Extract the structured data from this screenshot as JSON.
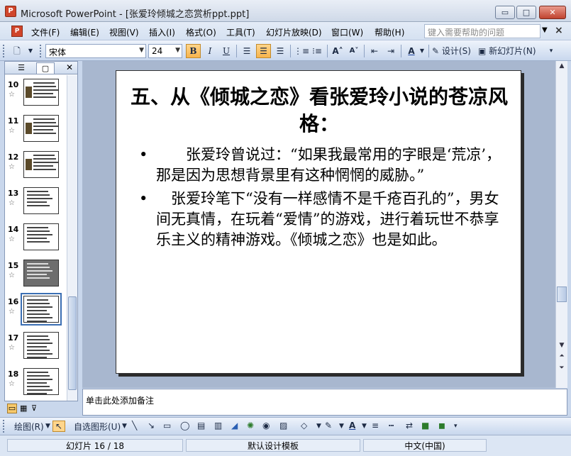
{
  "window": {
    "app_icon_letter": "P",
    "title": "Microsoft PowerPoint - [张爱玲倾城之恋赏析ppt.ppt]",
    "btn_min": "▭",
    "btn_max": "□",
    "btn_close": "✕"
  },
  "menu": {
    "items": [
      "文件(F)",
      "编辑(E)",
      "视图(V)",
      "插入(I)",
      "格式(O)",
      "工具(T)",
      "幻灯片放映(D)",
      "窗口(W)",
      "帮助(H)"
    ],
    "help_placeholder": "键入需要帮助的问题",
    "close": "×"
  },
  "toolbar": {
    "font_name": "宋体",
    "font_size": "24",
    "bold": "B",
    "italic": "I",
    "underline": "U",
    "design_label": "设计(S)",
    "new_slide_label": "新幻灯片(N)"
  },
  "outline_panel": {
    "slides": [
      {
        "num": "10",
        "style": "pic"
      },
      {
        "num": "11",
        "style": "pic"
      },
      {
        "num": "12",
        "style": "pic"
      },
      {
        "num": "13",
        "style": "plain"
      },
      {
        "num": "14",
        "style": "plain"
      },
      {
        "num": "15",
        "style": "dark"
      },
      {
        "num": "16",
        "style": "text",
        "selected": true
      },
      {
        "num": "17",
        "style": "text"
      },
      {
        "num": "18",
        "style": "text"
      }
    ]
  },
  "slide": {
    "title": "五、从《倾城之恋》看张爱玲小说的苍凉风格：",
    "bullets": [
      "　　张爱玲曾说过：“如果我最常用的字眼是‘荒凉’，那是因为思想背景里有这种惘惘的威胁。”",
      "　张爱玲笔下“没有一样感情不是千疮百孔的”，男女间无真情，在玩着“爱情”的游戏，进行着玩世不恭享乐主义的精神游戏。《倾城之恋》也是如此。"
    ]
  },
  "notes": {
    "placeholder": "单击此处添加备注"
  },
  "drawing_toolbar": {
    "draw_label": "绘图(R)",
    "autoshapes_label": "自选图形(U)"
  },
  "status": {
    "slide_pos": "幻灯片 16 / 18",
    "template": "默认设计模板",
    "language": "中文(中国)"
  }
}
